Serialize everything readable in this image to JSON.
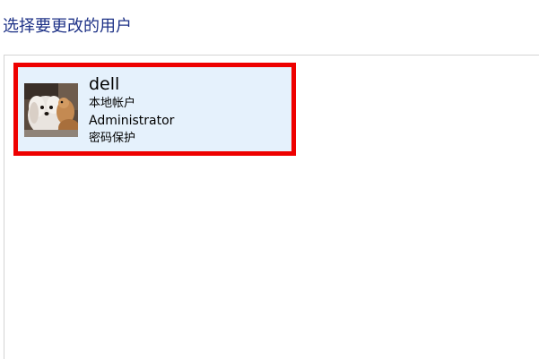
{
  "page": {
    "heading": "选择要更改的用户"
  },
  "user": {
    "name": "dell",
    "account_type": "本地帐户",
    "role": "Administrator",
    "protection": "密码保护",
    "avatar_icon": "dog-photo-avatar"
  },
  "colors": {
    "heading": "#1e3287",
    "tile_background": "#e5f1fc",
    "highlight_border": "#ee0000",
    "panel_border": "#d4d4d4"
  }
}
